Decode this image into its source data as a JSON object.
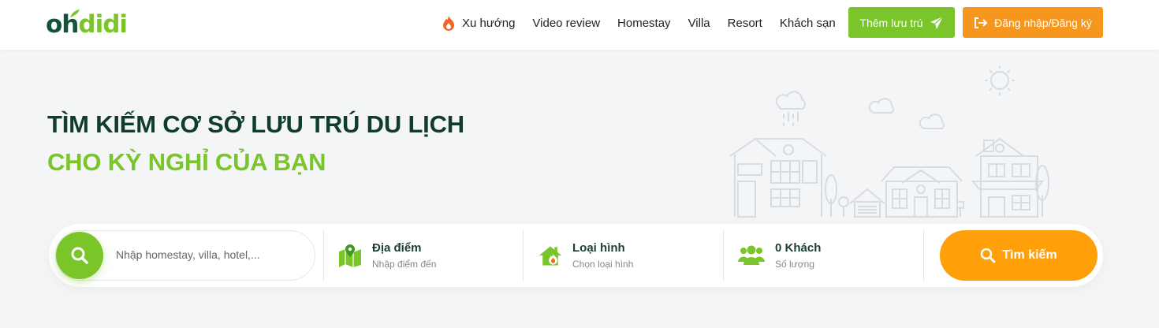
{
  "brand": {
    "logo_part1": "oh",
    "logo_part2": "didi"
  },
  "nav": {
    "items": [
      {
        "label": "Xu hướng",
        "icon": "fire-icon"
      },
      {
        "label": "Video review"
      },
      {
        "label": "Homestay"
      },
      {
        "label": "Villa"
      },
      {
        "label": "Resort"
      },
      {
        "label": "Khách sạn"
      }
    ],
    "add_label": "Thêm lưu trú",
    "login_label": "Đăng nhập/Đăng ký"
  },
  "hero": {
    "title_line1": "TÌM KIẾM CƠ SỞ LƯU TRÚ DU LỊCH",
    "title_line2": "CHO KỲ NGHỈ CỦA BẠN"
  },
  "search": {
    "placeholder": "Nhập homestay, villa, hotel,...",
    "location": {
      "label": "Địa điểm",
      "sub": "Nhập điểm đến",
      "icon": "map-pin-icon"
    },
    "type": {
      "label": "Loại hình",
      "sub": "Chọn loại hình",
      "icon": "house-fire-icon"
    },
    "guests": {
      "label": "0 Khách",
      "sub": "Số lượng",
      "icon": "users-icon"
    },
    "button_label": "Tìm kiếm"
  },
  "colors": {
    "primary_green": "#7ac62a",
    "dark_green": "#0f3d2a",
    "orange": "#f7961d",
    "search_orange": "#ff9f0a"
  }
}
